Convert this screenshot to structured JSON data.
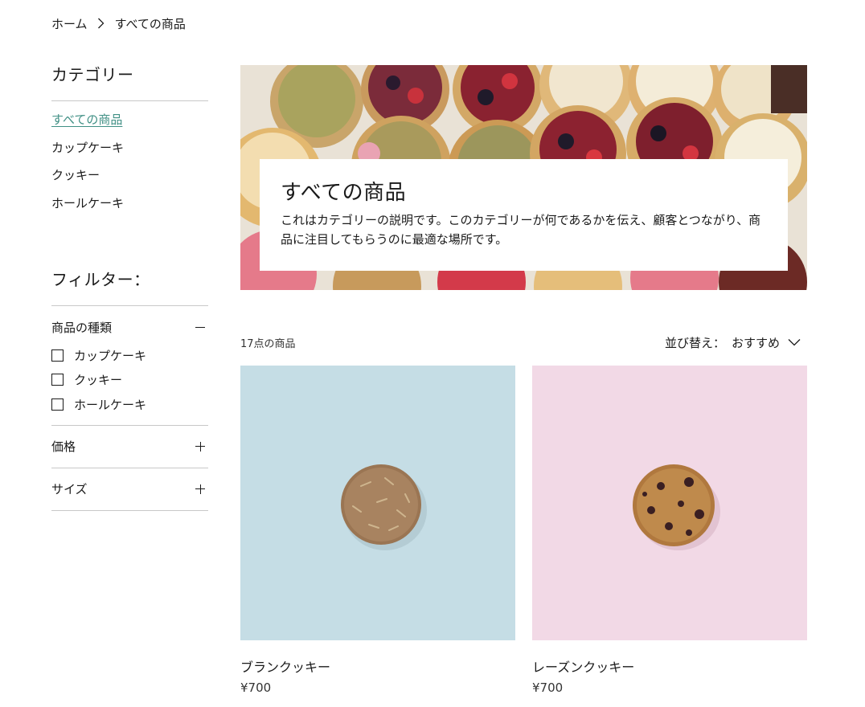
{
  "breadcrumb": {
    "home": "ホーム",
    "current": "すべての商品"
  },
  "sidebar": {
    "categories_title": "カテゴリー",
    "categories": [
      {
        "label": "すべての商品",
        "active": true
      },
      {
        "label": "カップケーキ",
        "active": false
      },
      {
        "label": "クッキー",
        "active": false
      },
      {
        "label": "ホールケーキ",
        "active": false
      }
    ],
    "filter_title": "フィルター：",
    "filters": {
      "product_type": {
        "label": "商品の種類",
        "expanded": true,
        "options": [
          "カップケーキ",
          "クッキー",
          "ホールケーキ"
        ]
      },
      "price": {
        "label": "価格",
        "expanded": false
      },
      "size": {
        "label": "サイズ",
        "expanded": false
      }
    }
  },
  "hero": {
    "title": "すべての商品",
    "description": "これはカテゴリーの説明です。このカテゴリーが何であるかを伝え、顧客とつながり、商品に注目してもらうのに最適な場所です。"
  },
  "toolbar": {
    "count": "17点の商品",
    "sort_label": "並び替え：",
    "sort_value": "おすすめ"
  },
  "products": [
    {
      "name": "ブランクッキー",
      "price": "¥700",
      "bg_color": "#c5dde5"
    },
    {
      "name": "レーズンクッキー",
      "price": "¥700",
      "bg_color": "#f2d9e6"
    }
  ],
  "colors": {
    "accent": "#3f8f84",
    "rule": "#c8c8c8"
  }
}
